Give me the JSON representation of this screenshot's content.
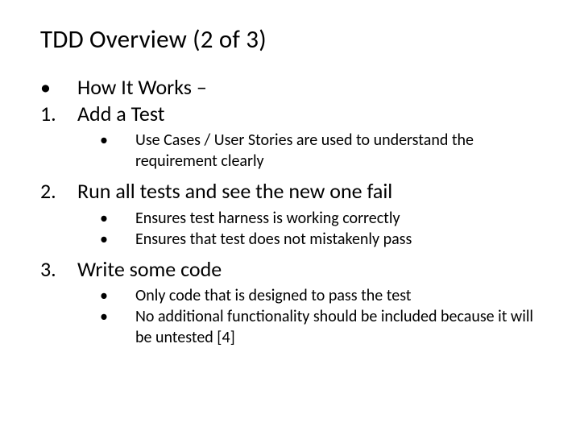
{
  "title": "TDD Overview (2 of 3)",
  "top_bullet": "How It Works –",
  "step1": {
    "marker": "1.",
    "text": "Add a Test",
    "sub": [
      "Use Cases / User Stories are used to understand the requirement clearly"
    ]
  },
  "step2": {
    "marker": "2.",
    "text": "Run all tests and see the new one fail",
    "sub": [
      "Ensures test harness is working correctly",
      "Ensures that test does not mistakenly pass"
    ]
  },
  "step3": {
    "marker": "3.",
    "text": "Write some code",
    "sub": [
      "Only code that is designed to pass the test",
      "No additional functionality should be included because it will be untested                      [4]"
    ]
  }
}
